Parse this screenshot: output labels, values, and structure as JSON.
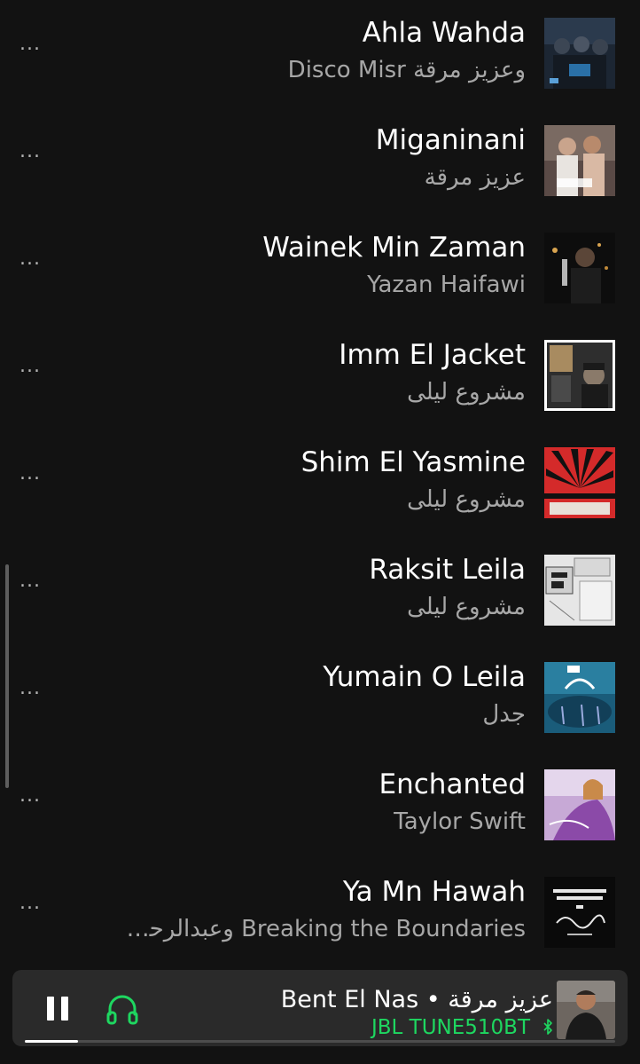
{
  "tracks": [
    {
      "title": "Ahla Wahda",
      "artist": "وعزيز مرقة Disco Misr",
      "more": "...",
      "art": "ahla-wahda-cover"
    },
    {
      "title": "Miganinani",
      "artist": "عزيز مرقة",
      "more": "...",
      "art": "miganinani-cover"
    },
    {
      "title": "Wainek Min Zaman",
      "artist": "Yazan Haifawi",
      "more": "...",
      "art": "wainek-min-zaman-cover"
    },
    {
      "title": "Imm El Jacket",
      "artist": "مشروع ليلى",
      "more": "...",
      "art": "imm-el-jacket-cover"
    },
    {
      "title": "Shim El Yasmine",
      "artist": "مشروع ليلى",
      "more": "...",
      "art": "shim-el-yasmine-cover"
    },
    {
      "title": "Raksit Leila",
      "artist": "مشروع ليلى",
      "more": "...",
      "art": "raksit-leila-cover"
    },
    {
      "title": "Yumain O Leila",
      "artist": "جدل",
      "more": "...",
      "art": "yumain-o-leila-cover"
    },
    {
      "title": "Enchanted",
      "artist": "Taylor Swift",
      "more": "...",
      "art": "enchanted-cover"
    },
    {
      "title": "Ya Mn Hawah",
      "artist": "Breaking the Boundaries وعبدالرحم...",
      "more": "...",
      "art": "ya-mn-hawah-cover"
    }
  ],
  "now_playing": {
    "title": "Bent El Nas • عزيز مرقة",
    "device": "JBL TUNE510BT",
    "progress": 0.09,
    "is_playing": true,
    "pause_icon": "pause-icon",
    "connect_icon": "headphones-icon",
    "bluetooth_icon": "bluetooth-icon"
  },
  "colors": {
    "background": "#121212",
    "player_background": "#2a2a2a",
    "accent": "#1ed760",
    "secondary_text": "#a7a7a7"
  }
}
